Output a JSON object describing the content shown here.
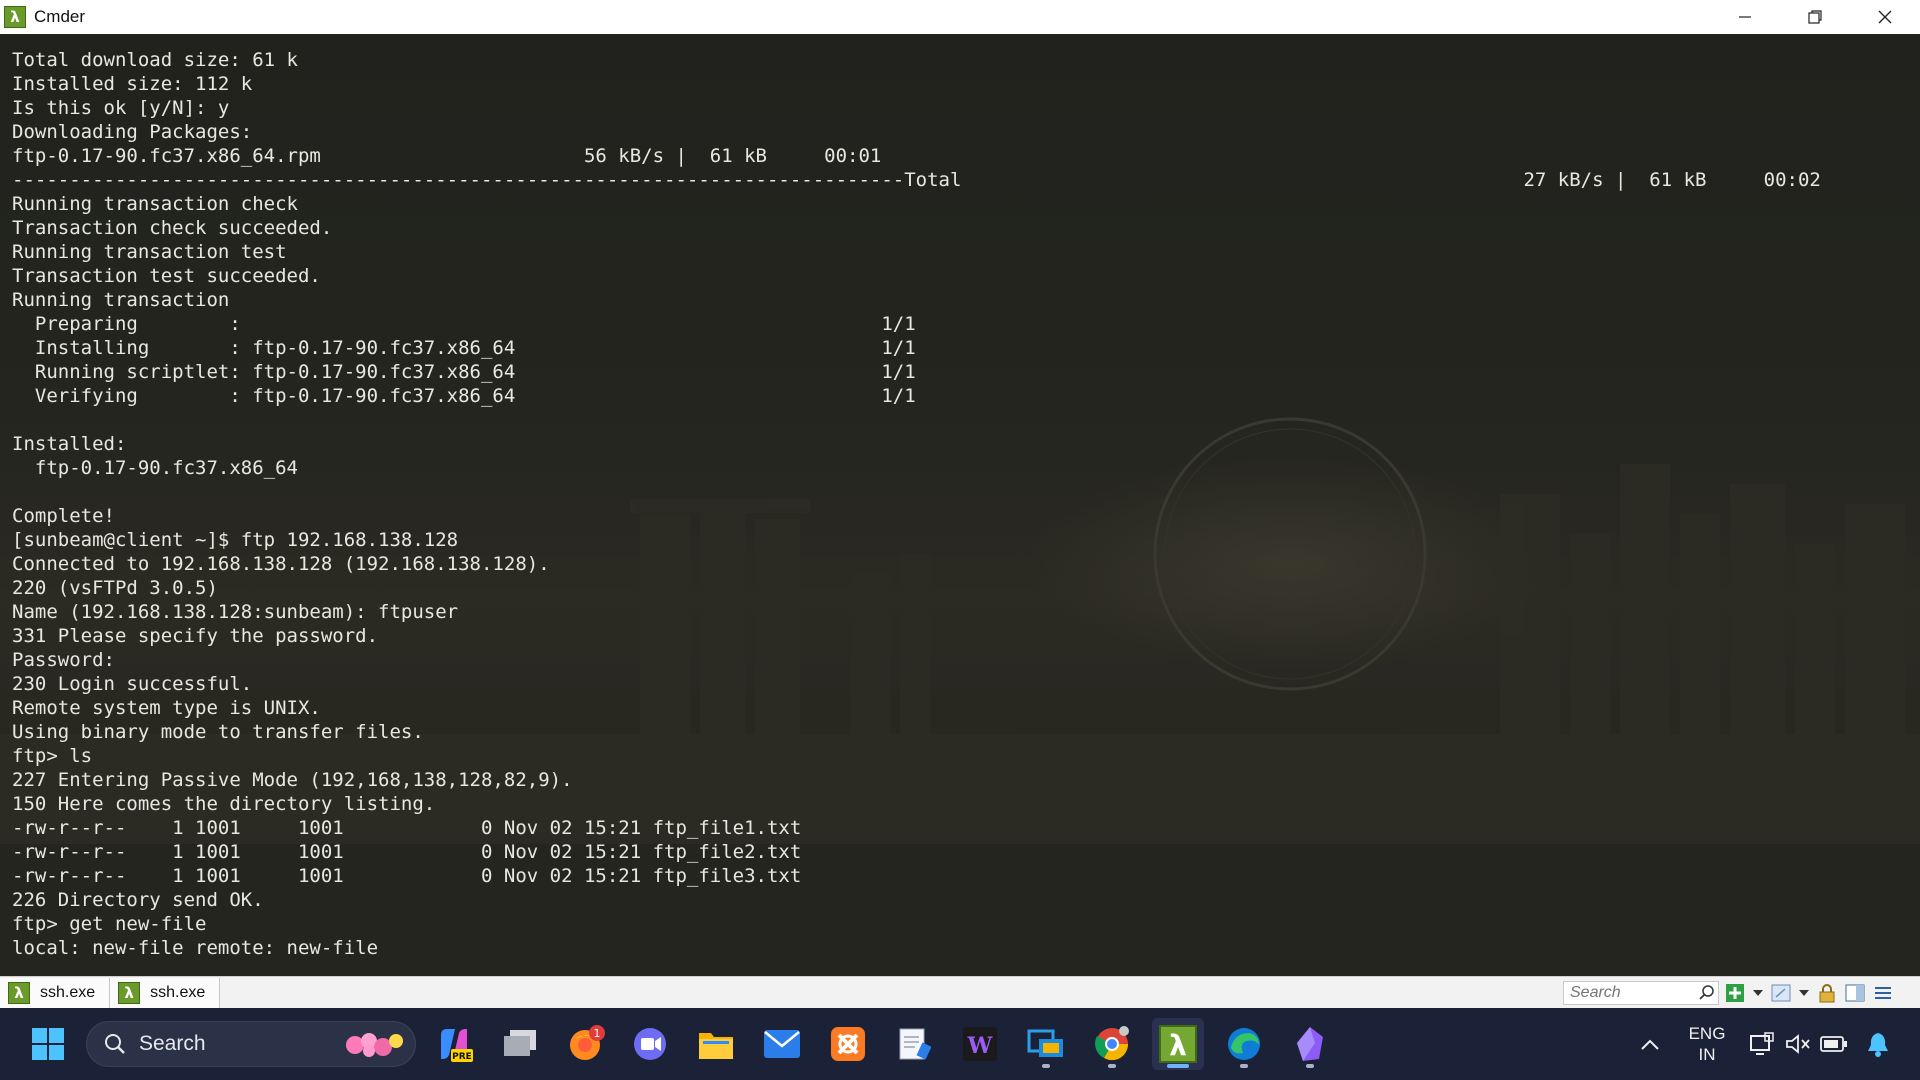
{
  "window": {
    "title": "Cmder",
    "app_icon_glyph": "λ",
    "icons": [
      "minimize-icon",
      "restore-icon",
      "close-icon"
    ]
  },
  "terminal": {
    "lines": [
      "Total download size: 61 k",
      "Installed size: 112 k",
      "Is this ok [y/N]: y",
      "Downloading Packages:",
      "ftp-0.17-90.fc37.x86_64.rpm                       56 kB/s |  61 kB     00:01",
      "------------------------------------------------------------------------------Total",
      "Running transaction check",
      "Transaction check succeeded.",
      "Running transaction test",
      "Transaction test succeeded.",
      "Running transaction",
      "  Preparing        :                                                        1/1",
      "  Installing       : ftp-0.17-90.fc37.x86_64                                1/1",
      "  Running scriptlet: ftp-0.17-90.fc37.x86_64                                1/1",
      "  Verifying        : ftp-0.17-90.fc37.x86_64                                1/1",
      "",
      "Installed:",
      "  ftp-0.17-90.fc37.x86_64",
      "",
      "Complete!",
      "[sunbeam@client ~]$ ftp 192.168.138.128",
      "Connected to 192.168.138.128 (192.168.138.128).",
      "220 (vsFTPd 3.0.5)",
      "Name (192.168.138.128:sunbeam): ftpuser",
      "331 Please specify the password.",
      "Password:",
      "230 Login successful.",
      "Remote system type is UNIX.",
      "Using binary mode to transfer files.",
      "ftp> ls",
      "227 Entering Passive Mode (192,168,138,128,82,9).",
      "150 Here comes the directory listing.",
      "-rw-r--r--    1 1001     1001            0 Nov 02 15:21 ftp_file1.txt",
      "-rw-r--r--    1 1001     1001            0 Nov 02 15:21 ftp_file2.txt",
      "-rw-r--r--    1 1001     1001            0 Nov 02 15:21 ftp_file3.txt",
      "226 Directory send OK.",
      "ftp> get new-file",
      "local: new-file remote: new-file"
    ],
    "total_stats": " 27 kB/s |  61 kB     00:02",
    "text_color": "#e8e8e0",
    "background_color": "#22231e"
  },
  "cmder_tabs": [
    {
      "label": "ssh.exe",
      "icon": "lambda-icon"
    },
    {
      "label": "ssh.exe",
      "icon": "lambda-icon"
    }
  ],
  "cmder_search": {
    "placeholder": "Search"
  },
  "cmder_tools": [
    "search-icon",
    "new-console-icon",
    "dropdown-icon",
    "view-icon",
    "dropdown-icon",
    "lock-icon",
    "split-view-icon",
    "menu-icon"
  ],
  "taskbar": {
    "search_label": "Search",
    "apps": [
      {
        "name": "windows-start-icon"
      },
      {
        "name": "copilot-pre-icon",
        "badge": "PRE"
      },
      {
        "name": "task-view-icon"
      },
      {
        "name": "firefox-icon",
        "badge": "1"
      },
      {
        "name": "teams-meet-icon"
      },
      {
        "name": "file-explorer-icon"
      },
      {
        "name": "mail-icon"
      },
      {
        "name": "xampp-icon"
      },
      {
        "name": "notepad-icon"
      },
      {
        "name": "winword-icon"
      },
      {
        "name": "remote-desktop-icon"
      },
      {
        "name": "chrome-icon"
      },
      {
        "name": "cmder-icon",
        "active": true
      },
      {
        "name": "edge-icon"
      },
      {
        "name": "obsidian-icon"
      }
    ],
    "tray": {
      "lang_line1": "ENG",
      "lang_line2": "IN",
      "icons": [
        "chevron-up-icon",
        "display-icon",
        "speaker-muted-icon",
        "battery-icon",
        "notification-bell-icon"
      ]
    },
    "accent_color": "#6fb3ff",
    "background_color": "#1b2136"
  }
}
